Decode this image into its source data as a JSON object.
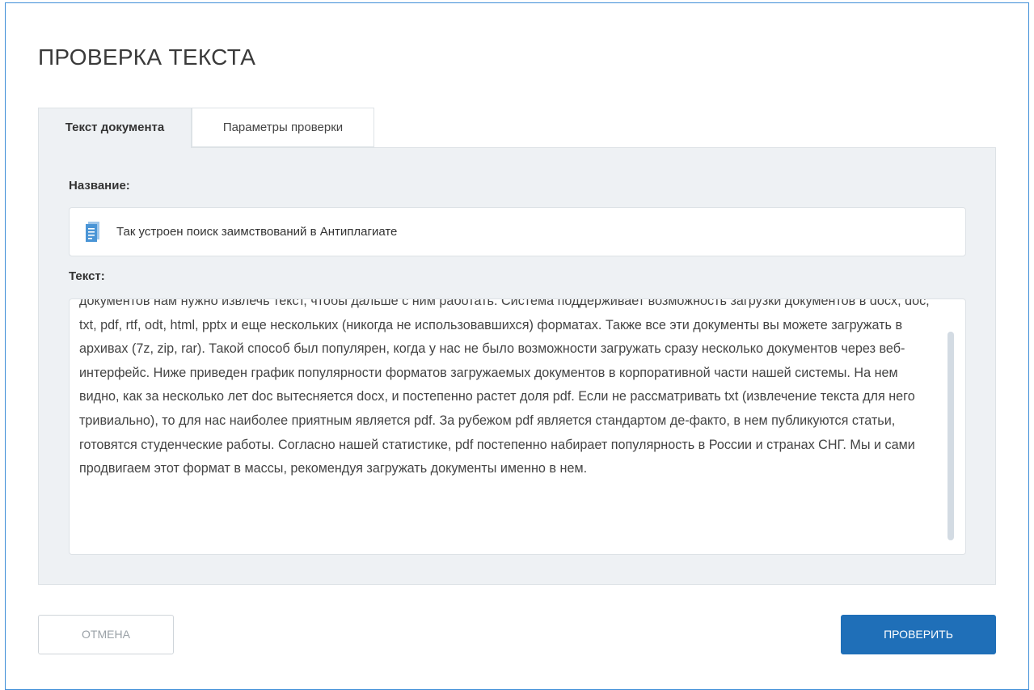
{
  "page": {
    "title": "ПРОВЕРКА ТЕКСТА"
  },
  "tabs": [
    {
      "label": "Текст документа",
      "active": true
    },
    {
      "label": "Параметры проверки",
      "active": false
    }
  ],
  "form": {
    "name_label": "Название:",
    "name_value": "Так устроен поиск заимствований в Антиплагиате",
    "name_icon": "document-icon",
    "text_label": "Текст:",
    "text_value": "документов нам нужно извлечь текст, чтобы дальше с ним работать. Система поддерживает возможность загрузки документов в docx, doc, txt, pdf, rtf, odt, html, pptx и еще нескольких (никогда не использовавшихся) форматах. Также все эти документы вы можете загружать в архивах (7z, zip, rar). Такой способ был популярен, когда у нас не было возможности загружать сразу несколько документов через веб-интерфейс. Ниже приведен график популярности форматов загружаемых документов в корпоративной части нашей системы. На нем видно, как за несколько лет doc вытесняется docx, и постепенно растет доля pdf. Если не рассматривать txt (извлечение текста для него тривиально), то для нас наиболее приятным является pdf. За рубежом pdf является стандартом де-факто, в нем публикуются статьи, готовятся студенческие работы. Согласно нашей статистике, pdf постепенно набирает популярность в России и странах СНГ. Мы и сами продвигаем этот формат в массы, рекомендуя загружать документы именно в нем."
  },
  "buttons": {
    "cancel_label": "Отмена",
    "check_label": "Проверить"
  },
  "colors": {
    "accent": "#1f6fb8",
    "frame_border": "#3f8fd8",
    "panel_bg": "#eef1f4"
  }
}
